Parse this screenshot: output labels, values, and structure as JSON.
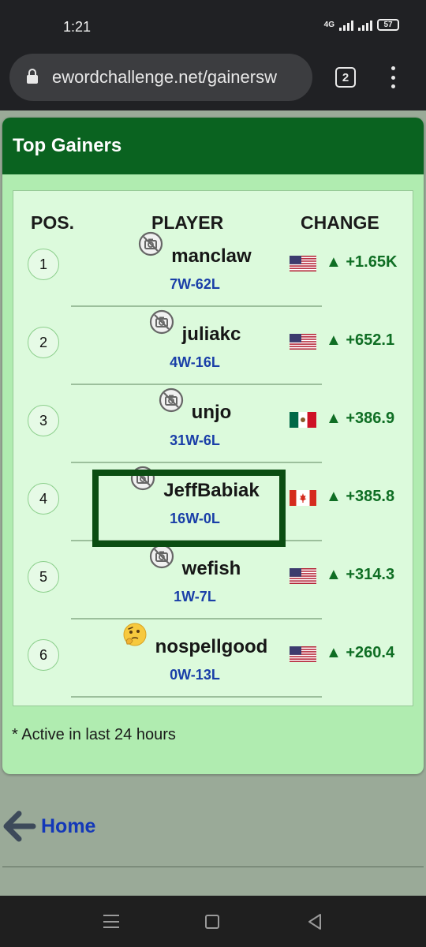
{
  "status_bar": {
    "time": "1:21",
    "network": "4G",
    "battery": "57"
  },
  "browser": {
    "url": "ewordchallenge.net/gainersw",
    "tab_count": "2"
  },
  "card": {
    "title": "Top Gainers",
    "columns": {
      "pos": "POS.",
      "player": "PLAYER",
      "change": "CHANGE"
    },
    "rows": [
      {
        "pos": "1",
        "name": "manclaw",
        "record": "7W-62L",
        "flag": "us",
        "change": "▲ +1.65K",
        "avatar": "no-photo-icon",
        "highlighted": false
      },
      {
        "pos": "2",
        "name": "juliakc",
        "record": "4W-16L",
        "flag": "us",
        "change": "▲ +652.1",
        "avatar": "no-photo-icon",
        "highlighted": false
      },
      {
        "pos": "3",
        "name": "unjo",
        "record": "31W-6L",
        "flag": "mx",
        "change": "▲ +386.9",
        "avatar": "no-photo-icon",
        "highlighted": false
      },
      {
        "pos": "4",
        "name": "JeffBabiak",
        "record": "16W-0L",
        "flag": "ca",
        "change": "▲ +385.8",
        "avatar": "no-photo-icon",
        "highlighted": true
      },
      {
        "pos": "5",
        "name": "wefish",
        "record": "1W-7L",
        "flag": "us",
        "change": "▲ +314.3",
        "avatar": "no-photo-icon",
        "highlighted": false
      },
      {
        "pos": "6",
        "name": "nospellgood",
        "record": "0W-13L",
        "flag": "us",
        "change": "▲ +260.4",
        "avatar": "thinking-face-icon",
        "highlighted": false
      }
    ],
    "footnote": "* Active in last 24 hours"
  },
  "home_link": {
    "label": "Home"
  },
  "colors": {
    "header": "#0a6320",
    "card_bg": "#b0ecb0",
    "inner_bg": "#dcfadc",
    "change_green": "#0f6e24",
    "record_blue": "#1a3fa8",
    "link_blue": "#1438b8"
  },
  "icons": {
    "arrow": "arrow-left-icon",
    "lock": "lock-icon",
    "menu": "more-vert-icon"
  }
}
